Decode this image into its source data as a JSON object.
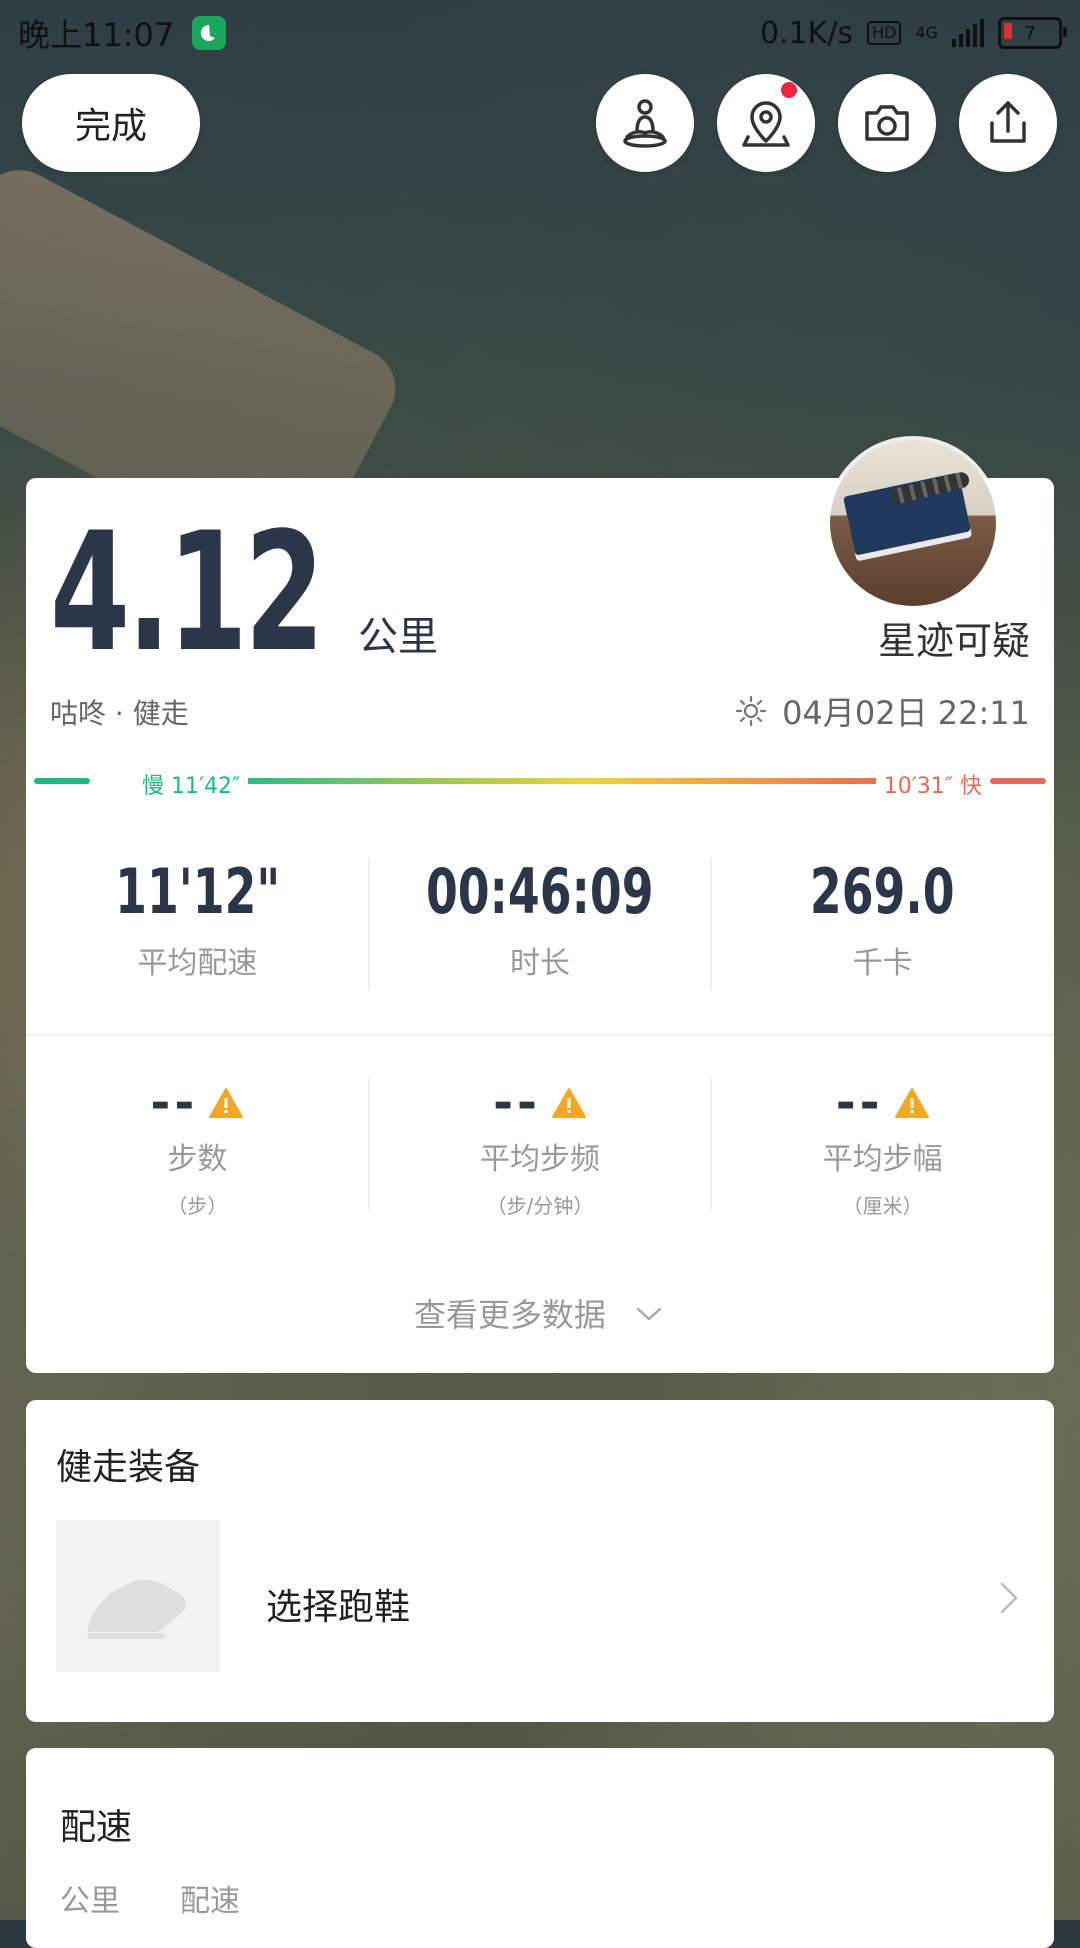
{
  "status_bar": {
    "time": "晚上11:07",
    "net_speed": "0.1K/s",
    "hd": "HD",
    "network": "4G",
    "battery": "7"
  },
  "top_bar": {
    "done_label": "完成",
    "buttons": [
      "meditation-icon",
      "map-pin-icon",
      "camera-icon",
      "share-icon"
    ]
  },
  "summary": {
    "distance": "4.12",
    "distance_unit": "公里",
    "nickname": "星迹可疑",
    "activity": "咕咚 · 健走",
    "datetime": "04月02日 22:11",
    "pace_slow": "慢 11′42″",
    "pace_fast": "10′31″ 快"
  },
  "stats_main": [
    {
      "value": "11'12\"",
      "label": "平均配速"
    },
    {
      "value": "00:46:09",
      "label": "时长"
    },
    {
      "value": "269.0",
      "label": "千卡"
    }
  ],
  "stats_secondary": [
    {
      "value": "--",
      "label": "步数",
      "unit": "（步）"
    },
    {
      "value": "--",
      "label": "平均步频",
      "unit": "（步/分钟）"
    },
    {
      "value": "--",
      "label": "平均步幅",
      "unit": "（厘米）"
    }
  ],
  "more_label": "查看更多数据",
  "equipment": {
    "title": "健走装备",
    "select_label": "选择跑鞋"
  },
  "pace_section": {
    "title": "配速",
    "columns": [
      "公里",
      "配速"
    ]
  },
  "colors": {
    "slow": "#1bb987",
    "mid": "#f2d13b",
    "fast": "#e36a55",
    "dark_text": "#2b3748",
    "notify": "#f0243c",
    "warn": "#f5a623"
  }
}
